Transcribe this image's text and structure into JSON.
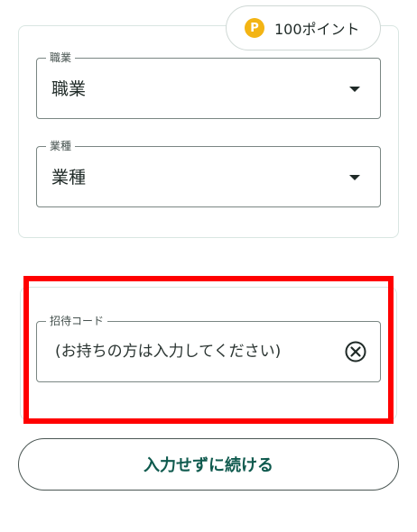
{
  "points": {
    "coin_symbol": "P",
    "label": "100ポイント",
    "coin_color": "#f3b414"
  },
  "job": {
    "legend": "職業",
    "value": "職業",
    "icon": "chevron-down-icon"
  },
  "industry": {
    "legend": "業種",
    "value": "業種",
    "icon": "chevron-down-icon"
  },
  "invite": {
    "legend": "招待コード",
    "placeholder": "(お持ちの方は入力してください)",
    "clear_icon": "clear-circle-icon"
  },
  "actions": {
    "continue_label": "入力せずに続ける"
  },
  "colors": {
    "highlight": "#ff0000",
    "primary_text": "#0f5a4e",
    "border": "#d9e6e2"
  }
}
